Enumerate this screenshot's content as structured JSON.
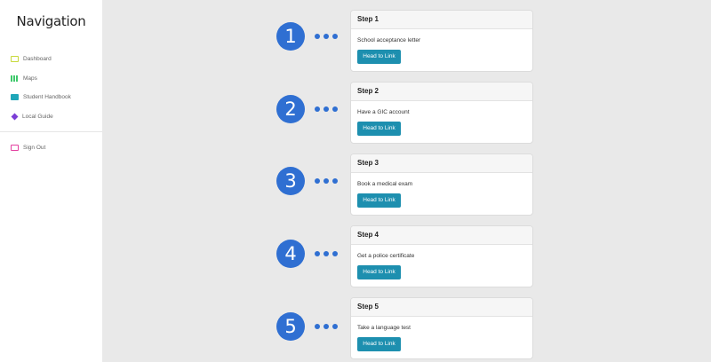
{
  "sidebar": {
    "title": "Navigation",
    "items": [
      {
        "label": "Dashboard",
        "icon": "dashboard-icon"
      },
      {
        "label": "Maps",
        "icon": "maps-icon"
      },
      {
        "label": "Student Handbook",
        "icon": "book-icon"
      },
      {
        "label": "Local Guide",
        "icon": "guide-icon"
      }
    ],
    "signout": {
      "label": "Sign Out",
      "icon": "sign-out-icon"
    }
  },
  "steps": [
    {
      "number": "1",
      "title": "Step 1",
      "text": "School acceptance letter",
      "button": "Head to Link"
    },
    {
      "number": "2",
      "title": "Step 2",
      "text": "Have a GIC account",
      "button": "Head to Link"
    },
    {
      "number": "3",
      "title": "Step 3",
      "text": "Book a medical exam",
      "button": "Head to Link"
    },
    {
      "number": "4",
      "title": "Step 4",
      "text": "Get a police certificate",
      "button": "Head to Link"
    },
    {
      "number": "5",
      "title": "Step 5",
      "text": "Take a language test",
      "button": "Head to Link"
    }
  ],
  "colors": {
    "accent": "#2f6fd2",
    "button": "#1d8faf",
    "background": "#e9e9e9"
  }
}
